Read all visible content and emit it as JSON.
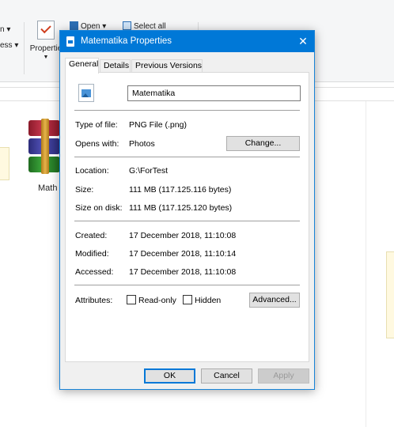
{
  "explorer": {
    "ribbon_left_items": [
      "n ▾",
      "ess ▾"
    ],
    "properties_label": "Propertie",
    "open_label": "Open ▾",
    "select_all_label": "Select all",
    "file_label": "Math"
  },
  "dialog": {
    "title": "Matematika Properties",
    "close_glyph": "✕",
    "tabs": [
      {
        "label": "General",
        "active": true
      },
      {
        "label": "Details",
        "active": false
      },
      {
        "label": "Previous Versions",
        "active": false
      }
    ],
    "file_name": "Matematika",
    "type_of_file": {
      "label": "Type of file:",
      "value": "PNG File (.png)"
    },
    "opens_with": {
      "label": "Opens with:",
      "value": "Photos",
      "button": "Change..."
    },
    "location": {
      "label": "Location:",
      "value": "G:\\ForTest"
    },
    "size": {
      "label": "Size:",
      "value": "111 MB (117.125.116 bytes)"
    },
    "size_on_disk": {
      "label": "Size on disk:",
      "value": "111 MB (117.125.120 bytes)"
    },
    "created": {
      "label": "Created:",
      "value": "17 December 2018, 11:10:08"
    },
    "modified": {
      "label": "Modified:",
      "value": "17 December 2018, 11:10:14"
    },
    "accessed": {
      "label": "Accessed:",
      "value": "17 December 2018, 11:10:08"
    },
    "attributes": {
      "label": "Attributes:",
      "read_only": {
        "label": "Read-only",
        "checked": false
      },
      "hidden": {
        "label": "Hidden",
        "checked": false
      },
      "advanced_button": "Advanced..."
    },
    "buttons": {
      "ok": "OK",
      "cancel": "Cancel",
      "apply": "Apply"
    },
    "colors": {
      "titlebar": "#0078d7",
      "accent_border": "#0078d7",
      "disabled_text": "#9a9a9a"
    }
  }
}
